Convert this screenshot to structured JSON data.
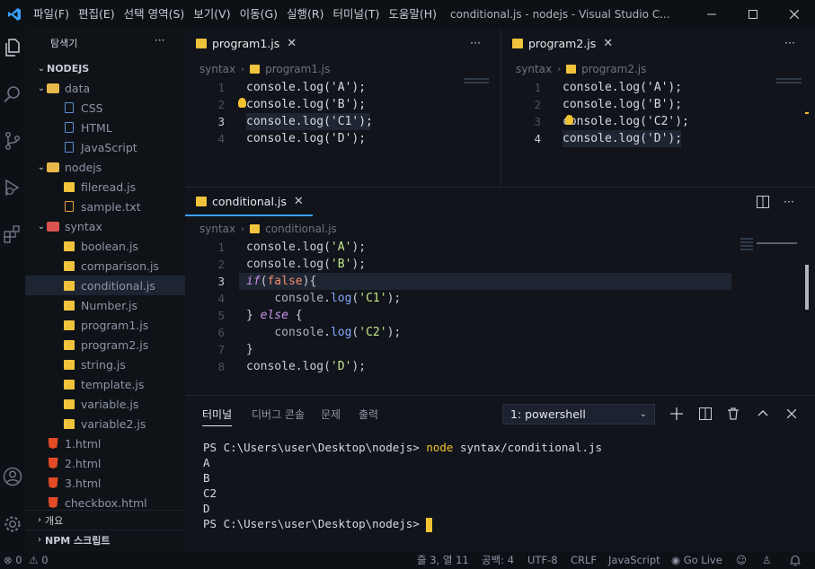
{
  "titlebar": {
    "menus": [
      "파일(F)",
      "편집(E)",
      "선택 영역(S)",
      "보기(V)",
      "이동(G)",
      "실행(R)",
      "터미널(T)",
      "도움말(H)"
    ],
    "window_title": "conditional.js - nodejs - Visual Studio C..."
  },
  "sidebar": {
    "title": "탐색기",
    "more": "···",
    "root": "NODEJS",
    "tree": [
      {
        "label": "data",
        "kind": "folder-open",
        "depth": 1
      },
      {
        "label": "CSS",
        "kind": "file",
        "depth": 2
      },
      {
        "label": "HTML",
        "kind": "file",
        "depth": 2
      },
      {
        "label": "JavaScript",
        "kind": "file",
        "depth": 2
      },
      {
        "label": "nodejs",
        "kind": "folder-open",
        "depth": 1
      },
      {
        "label": "fileread.js",
        "kind": "js",
        "depth": 2
      },
      {
        "label": "sample.txt",
        "kind": "txt",
        "depth": 2
      },
      {
        "label": "syntax",
        "kind": "folder-open-red",
        "depth": 1
      },
      {
        "label": "boolean.js",
        "kind": "js",
        "depth": 2
      },
      {
        "label": "comparison.js",
        "kind": "js",
        "depth": 2
      },
      {
        "label": "conditional.js",
        "kind": "js",
        "depth": 2,
        "active": true
      },
      {
        "label": "Number.js",
        "kind": "js",
        "depth": 2
      },
      {
        "label": "program1.js",
        "kind": "js",
        "depth": 2
      },
      {
        "label": "program2.js",
        "kind": "js",
        "depth": 2
      },
      {
        "label": "string.js",
        "kind": "js",
        "depth": 2
      },
      {
        "label": "template.js",
        "kind": "js",
        "depth": 2
      },
      {
        "label": "variable.js",
        "kind": "js",
        "depth": 2
      },
      {
        "label": "variable2.js",
        "kind": "js",
        "depth": 2
      },
      {
        "label": "1.html",
        "kind": "html",
        "depth": 1
      },
      {
        "label": "2.html",
        "kind": "html",
        "depth": 1
      },
      {
        "label": "3.html",
        "kind": "html",
        "depth": 1
      },
      {
        "label": "checkbox.html",
        "kind": "html",
        "depth": 1
      }
    ],
    "outline": "개요",
    "npm_scripts": "NPM 스크립트"
  },
  "editors": {
    "program1": {
      "tab": "program1.js",
      "breadcrumb_folder": "syntax",
      "breadcrumb_file": "program1.js",
      "lines": [
        {
          "n": "1",
          "text": "console.log('A');"
        },
        {
          "n": "2",
          "text": "console.log('B');"
        },
        {
          "n": "3",
          "text": "console.log('C1');"
        },
        {
          "n": "4",
          "text": "console.log('D');"
        }
      ]
    },
    "program2": {
      "tab": "program2.js",
      "breadcrumb_folder": "syntax",
      "breadcrumb_file": "program2.js",
      "lines": [
        {
          "n": "1",
          "text": "console.log('A');"
        },
        {
          "n": "2",
          "text": "console.log('B');"
        },
        {
          "n": "3",
          "text": "console.log('C2');"
        },
        {
          "n": "4",
          "text": "console.log('D');"
        }
      ]
    },
    "conditional": {
      "tab": "conditional.js",
      "breadcrumb_folder": "syntax",
      "breadcrumb_file": "conditional.js",
      "line_numbers": [
        "1",
        "2",
        "3",
        "4",
        "5",
        "6",
        "7",
        "8"
      ]
    }
  },
  "panel": {
    "tabs": [
      "터미널",
      "디버그 콘솔",
      "문제",
      "출력"
    ],
    "terminal_select": "1: powershell",
    "prompt": "PS C:\\Users\\user\\Desktop\\nodejs> ",
    "command": "node",
    "command_args": " syntax/conditional.js",
    "output": [
      "A",
      "B",
      "C2",
      "D"
    ],
    "prompt2": "PS C:\\Users\\user\\Desktop\\nodejs> "
  },
  "statusbar": {
    "errors": "0",
    "warnings": "0",
    "position": "줄 3, 열 11",
    "spaces": "공백: 4",
    "encoding": "UTF-8",
    "eol": "CRLF",
    "language": "JavaScript",
    "golive": "Go Live"
  },
  "colors": {
    "accent": "#3aa0ff",
    "js_icon": "#f0c33c",
    "html_icon": "#e34c26",
    "cursor": "#f2c230"
  }
}
